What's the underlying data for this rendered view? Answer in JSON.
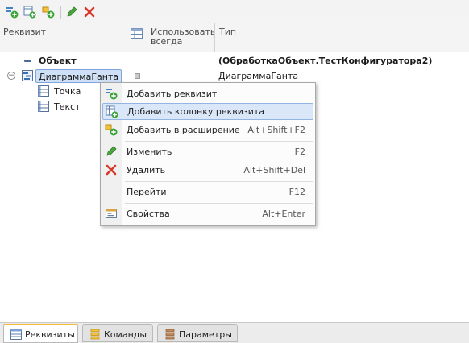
{
  "toolbar": {
    "icons": [
      "add-attribute-icon",
      "add-column-icon",
      "add-to-extension-icon",
      "edit-icon",
      "delete-icon"
    ]
  },
  "grid": {
    "columns": [
      "Реквизит",
      "Использовать всегда",
      "Тип"
    ],
    "rows": [
      {
        "name": "Объект",
        "type": "(ОбработкаОбъект.ТестКонфигуратора2)"
      },
      {
        "name": "ДиаграммаГанта",
        "type": "ДиаграммаГанта"
      },
      {
        "name": "Точка",
        "type": ""
      },
      {
        "name": "Текст",
        "type": ""
      }
    ]
  },
  "context_menu": {
    "items": [
      {
        "label": "Добавить реквизит",
        "shortcut": "",
        "icon": "add-attribute-icon"
      },
      {
        "label": "Добавить колонку реквизита",
        "shortcut": "",
        "icon": "add-column-icon",
        "highlighted": true
      },
      {
        "label": "Добавить в расширение",
        "shortcut": "Alt+Shift+F2",
        "icon": "add-to-extension-icon"
      },
      {
        "label": "Изменить",
        "shortcut": "F2",
        "icon": "edit-icon"
      },
      {
        "label": "Удалить",
        "shortcut": "Alt+Shift+Del",
        "icon": "delete-icon"
      },
      {
        "label": "Перейти",
        "shortcut": "F12",
        "icon": ""
      },
      {
        "label": "Свойства",
        "shortcut": "Alt+Enter",
        "icon": "properties-icon"
      }
    ]
  },
  "tabs": [
    {
      "label": "Реквизиты",
      "active": true
    },
    {
      "label": "Команды",
      "active": false
    },
    {
      "label": "Параметры",
      "active": false
    }
  ],
  "colors": {
    "accent": "#f2b93b",
    "selection": "#cfe0f6",
    "menu_highlight": "#d9e7f9"
  }
}
